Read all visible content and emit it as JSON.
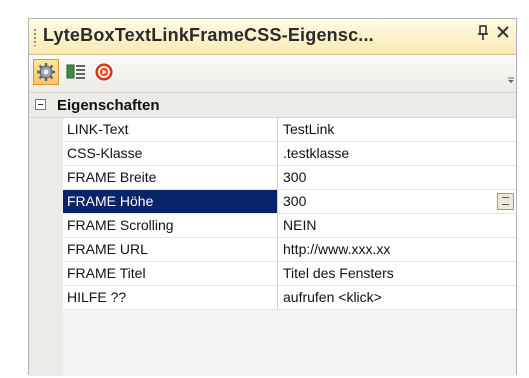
{
  "window": {
    "title": "LyteBoxTextLinkFrameCSS-Eigensc...",
    "pin_glyph": "१",
    "close_glyph": "✕"
  },
  "toolbar": {
    "buttons": [
      {
        "name": "properties-gear-icon",
        "active": true
      },
      {
        "name": "events-list-icon",
        "active": false
      },
      {
        "name": "stop-icon",
        "active": false
      }
    ]
  },
  "category": {
    "label": "Eigenschaften",
    "expanded": true
  },
  "properties": [
    {
      "name": "LINK-Text",
      "value": "TestLink"
    },
    {
      "name": "CSS-Klasse",
      "value": ".testklasse"
    },
    {
      "name": "FRAME Breite",
      "value": "300"
    },
    {
      "name": "FRAME Höhe",
      "value": "300",
      "selected": true
    },
    {
      "name": "FRAME Scrolling",
      "value": "NEIN"
    },
    {
      "name": "FRAME URL",
      "value": "http://www.xxx.xx"
    },
    {
      "name": "FRAME Titel",
      "value": "Titel des Fensters"
    },
    {
      "name": "HILFE ??",
      "value": "aufrufen <klick>"
    }
  ],
  "colors": {
    "selection": "#0a246a",
    "titlebar": "#f9e9b3",
    "toolbar_active": "#f5c868"
  }
}
